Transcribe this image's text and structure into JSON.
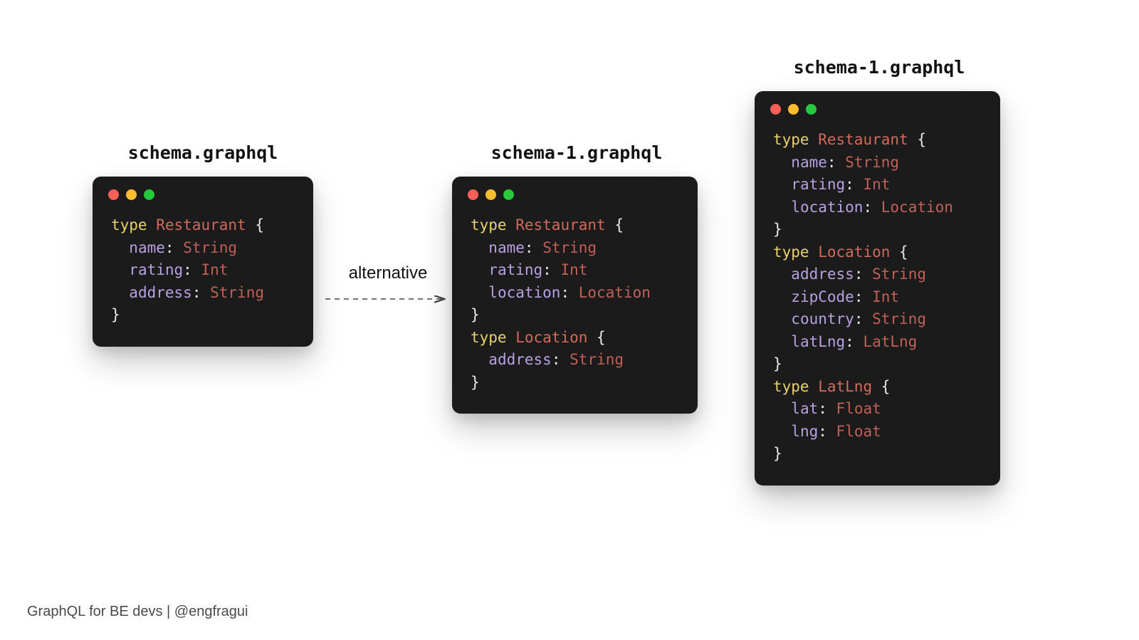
{
  "titles": {
    "left": "schema.graphql",
    "middle": "schema-1.graphql",
    "right": "schema-1.graphql"
  },
  "arrow_label": "alternative",
  "footer": "GraphQL for BE devs | @engfragui",
  "schemas": {
    "left": [
      {
        "typeName": "Restaurant",
        "fields": [
          {
            "name": "name",
            "type": "String"
          },
          {
            "name": "rating",
            "type": "Int"
          },
          {
            "name": "address",
            "type": "String"
          }
        ]
      }
    ],
    "middle": [
      {
        "typeName": "Restaurant",
        "fields": [
          {
            "name": "name",
            "type": "String"
          },
          {
            "name": "rating",
            "type": "Int"
          },
          {
            "name": "location",
            "type": "Location"
          }
        ]
      },
      {
        "typeName": "Location",
        "fields": [
          {
            "name": "address",
            "type": "String"
          }
        ]
      }
    ],
    "right": [
      {
        "typeName": "Restaurant",
        "fields": [
          {
            "name": "name",
            "type": "String"
          },
          {
            "name": "rating",
            "type": "Int"
          },
          {
            "name": "location",
            "type": "Location"
          }
        ]
      },
      {
        "typeName": "Location",
        "fields": [
          {
            "name": "address",
            "type": "String"
          },
          {
            "name": "zipCode",
            "type": "Int"
          },
          {
            "name": "country",
            "type": "String"
          },
          {
            "name": "latLng",
            "type": "LatLng"
          }
        ]
      },
      {
        "typeName": "LatLng",
        "fields": [
          {
            "name": "lat",
            "type": "Float"
          },
          {
            "name": "lng",
            "type": "Float"
          }
        ]
      }
    ]
  }
}
